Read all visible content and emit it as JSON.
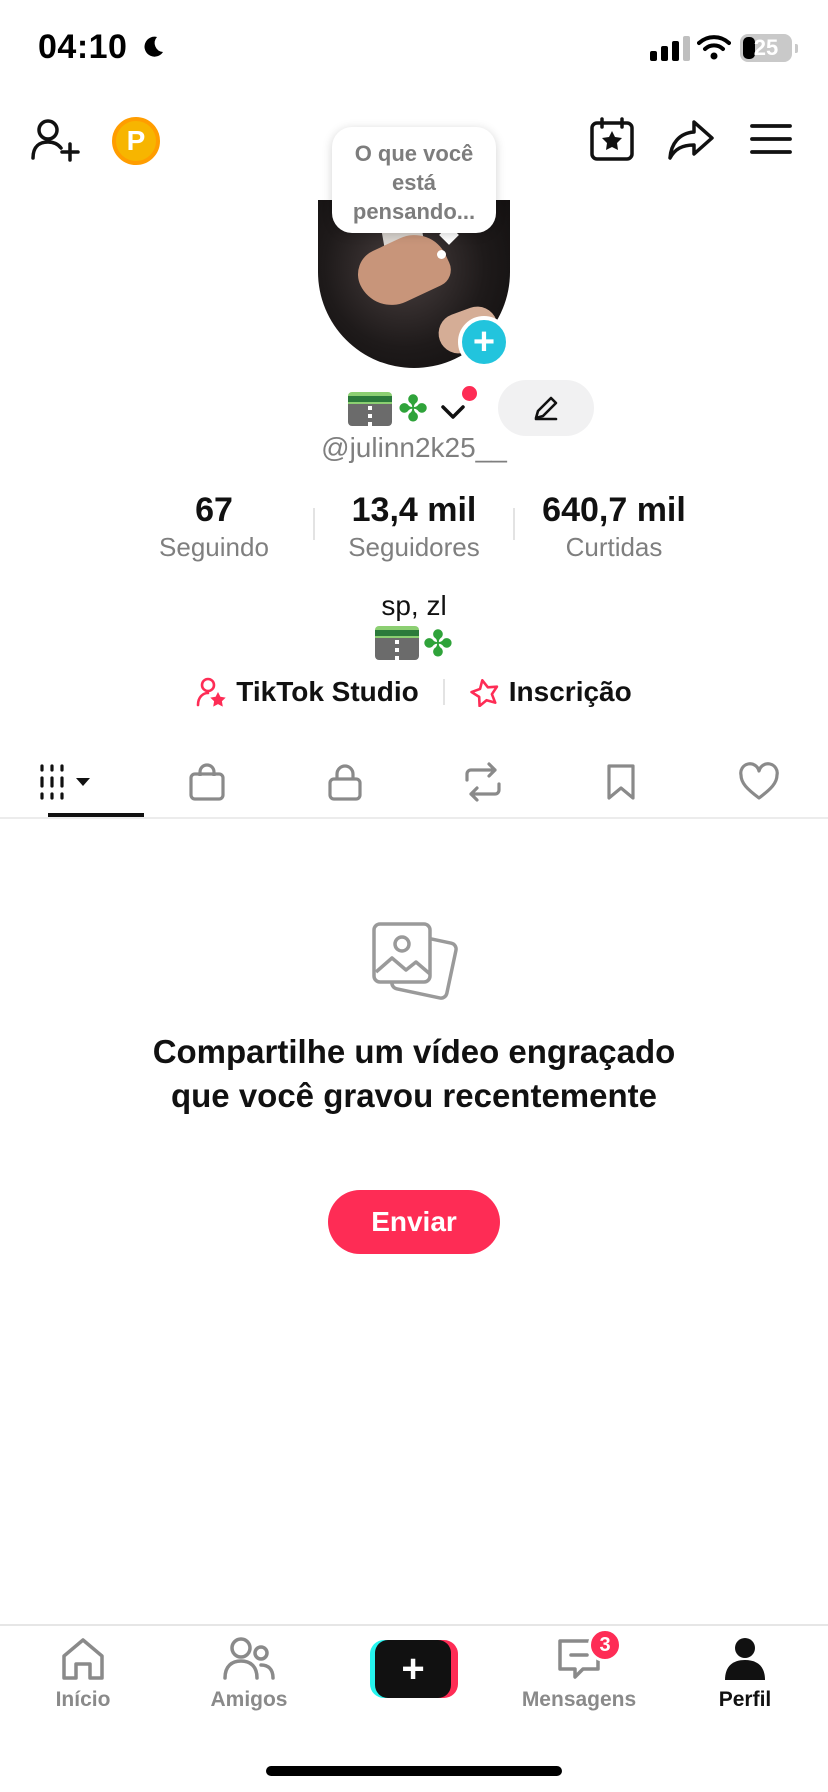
{
  "status_bar": {
    "time": "04:10",
    "battery": "25"
  },
  "header": {
    "coin_letter": "P"
  },
  "bubble": {
    "text": "O que você está pensando..."
  },
  "profile": {
    "display_name_emojis": [
      "road-emoji",
      "four-leaf-clover-emoji"
    ],
    "username": "@julinn2k25__"
  },
  "stats": [
    {
      "value": "67",
      "label": "Seguindo"
    },
    {
      "value": "13,4 mil",
      "label": "Seguidores"
    },
    {
      "value": "640,7 mil",
      "label": "Curtidas"
    }
  ],
  "bio": {
    "line1": "sp, zl"
  },
  "links": {
    "studio": "TikTok Studio",
    "subscription": "Inscrição"
  },
  "tabs": [
    "videos-grid",
    "shop",
    "private",
    "reposts",
    "favorites",
    "liked"
  ],
  "empty_state": {
    "title": "Compartilhe um vídeo engraçado que você gravou recentemente",
    "button": "Enviar"
  },
  "bottom_nav": {
    "items": [
      {
        "label": "Início",
        "icon": "home-icon"
      },
      {
        "label": "Amigos",
        "icon": "friends-icon"
      },
      {
        "label": "",
        "icon": "create-icon"
      },
      {
        "label": "Mensagens",
        "icon": "inbox-icon",
        "badge": "3"
      },
      {
        "label": "Perfil",
        "icon": "profile-icon",
        "active": true
      }
    ]
  },
  "colors": {
    "accent": "#fe2c55",
    "cyan": "#25f4ee",
    "coin": "#f7b500"
  }
}
